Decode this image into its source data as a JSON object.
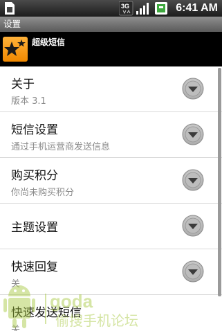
{
  "status_bar": {
    "time": "6:41 AM",
    "network": "3G",
    "icons": [
      "sim-icon",
      "3g-icon",
      "signal-icon",
      "battery-icon"
    ]
  },
  "title_bar": {
    "title": "设置"
  },
  "app_header": {
    "name": "超级短信"
  },
  "settings": [
    {
      "title": "关于",
      "subtitle": "版本 3.1"
    },
    {
      "title": "短信设置",
      "subtitle": "通过手机运营商发送信息"
    },
    {
      "title": "购买积分",
      "subtitle": "你尚未购买积分"
    },
    {
      "title": "主题设置",
      "subtitle": ""
    },
    {
      "title": "快速回复",
      "subtitle": "关"
    },
    {
      "title": "快速发送短信",
      "subtitle": "关"
    }
  ],
  "watermark": {
    "brand": "goda",
    "text": "偷搜手机论坛"
  },
  "colors": {
    "accent": "#f39200",
    "status_bar": "#1c1c1c",
    "title_bar": "#6e6e6e"
  }
}
